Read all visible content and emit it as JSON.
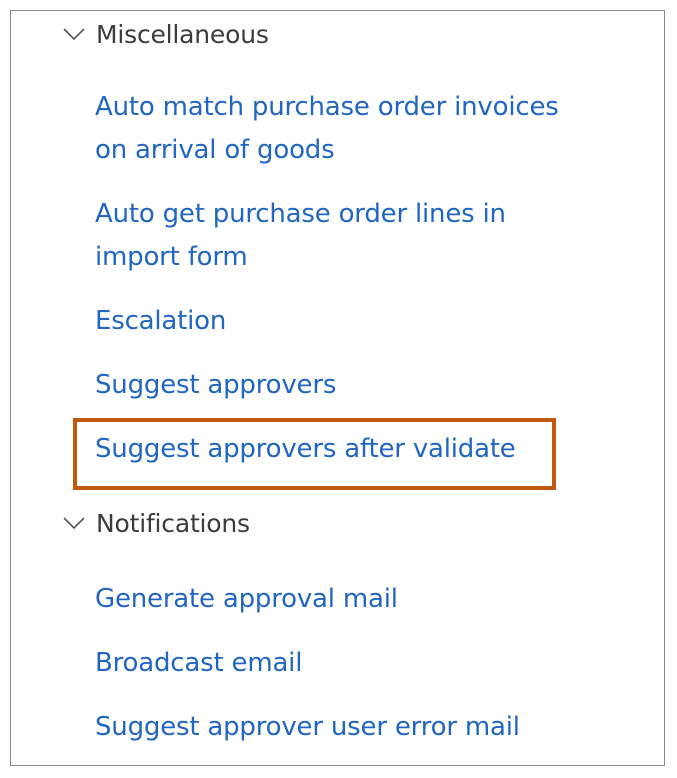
{
  "sections": [
    {
      "label": "Miscellaneous",
      "items": [
        {
          "lines": [
            "Auto match purchase order invoices",
            "on arrival of goods"
          ]
        },
        {
          "lines": [
            "Auto get purchase order lines in",
            "import form"
          ]
        },
        {
          "lines": [
            "Escalation"
          ]
        },
        {
          "lines": [
            "Suggest approvers"
          ]
        },
        {
          "lines": [
            "Suggest approvers after validate"
          ]
        }
      ]
    },
    {
      "label": "Notifications",
      "items": [
        {
          "lines": [
            "Generate approval mail"
          ]
        },
        {
          "lines": [
            "Broadcast email"
          ]
        },
        {
          "lines": [
            "Suggest approver user error mail"
          ]
        }
      ]
    }
  ],
  "icons": {
    "chevron": "chevron-down-icon"
  },
  "colors": {
    "link": "#2166c2",
    "header_text": "#3c3c3c",
    "highlight": "#c0590b",
    "border": "#8a8a8a"
  }
}
